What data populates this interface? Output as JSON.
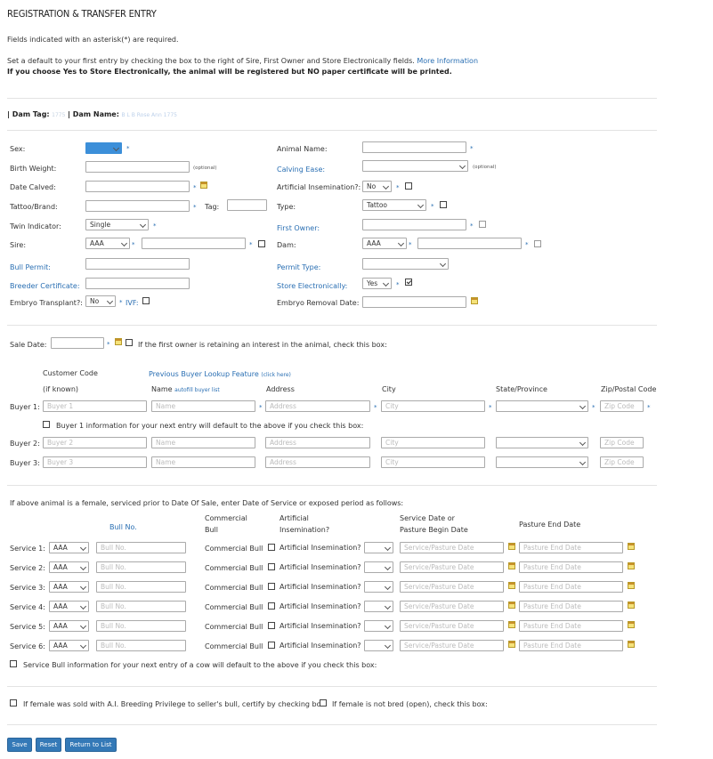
{
  "page": {
    "title": "REGISTRATION & TRANSFER ENTRY",
    "required_note": "Fields indicated with an asterisk(*) are required.",
    "default_note": "Set a default to your first entry by checking the box to the right of Sire, First Owner and Store Electronically fields.",
    "more_info": "More Information",
    "warning": "If you choose Yes to Store Electronically, the animal will be registered but NO paper certificate will be printed."
  },
  "dam": {
    "prefix": "| Dam Tag:",
    "tag_value": "1775",
    "mid": "| Dam Name:",
    "name_value": "B L B Rose Ann 1775"
  },
  "form": {
    "sex_label": "Sex:",
    "birth_weight_label": "Birth Weight:",
    "optional": "(optional)",
    "date_calved_label": "Date Calved:",
    "tattoo_label": "Tattoo/Brand:",
    "tag_label": "Tag:",
    "twin_label": "Twin Indicator:",
    "twin_value": "Single",
    "sire_label": "Sire:",
    "breed_value": "AAA",
    "bull_permit_label": "Bull Permit:",
    "breeder_cert_label": "Breeder Certificate:",
    "embryo_label": "Embryo Transplant?:",
    "no_value": "No",
    "ivf_label": "IVF:",
    "animal_name_label": "Animal Name:",
    "calving_ease_label": "Calving Ease:",
    "ai_label": "Artificial Insemination?:",
    "type_label": "Type:",
    "type_value": "Tattoo",
    "first_owner_label": "First Owner:",
    "dam_label": "Dam:",
    "permit_type_label": "Permit Type:",
    "store_label": "Store Electronically:",
    "yes_value": "Yes",
    "embryo_removal_label": "Embryo Removal Date:",
    "req": "*"
  },
  "sale": {
    "label": "Sale Date:",
    "retain_text": "If the first owner is retaining an interest in the animal, check this box:"
  },
  "buyers": {
    "customer_code": "Customer Code",
    "if_known": "(if known)",
    "lookup": "Previous Buyer Lookup Feature",
    "click_here": "(click here)",
    "name_col": "Name",
    "autofill": "autofill buyer list",
    "address_col": "Address",
    "city_col": "City",
    "state_col": "State/Province",
    "zip_col": "Zip/Postal Code",
    "default_text": "Buyer 1 information for your next entry will default to the above if you check this box:",
    "name_ph": "Name",
    "address_ph": "Address",
    "city_ph": "City",
    "zip_ph": "Zip Code",
    "rows": [
      {
        "label": "Buyer 1:",
        "code_ph": "Buyer 1"
      },
      {
        "label": "Buyer 2:",
        "code_ph": "Buyer 2"
      },
      {
        "label": "Buyer 3:",
        "code_ph": "Buyer 3"
      }
    ]
  },
  "services": {
    "intro": "If above animal is a female, serviced prior to Date Of Sale, enter Date of Service or exposed period as follows:",
    "bull_no_col": "Bull No.",
    "commercial_col_1": "Commercial",
    "commercial_col_2": "Bull",
    "ai_col_1": "Artificial",
    "ai_col_2": "Insemination?",
    "service_date_col_1": "Service Date or",
    "service_date_col_2": "Pasture Begin Date",
    "pasture_end_col": "Pasture End Date",
    "bull_ph": "Bull No.",
    "commercial_bull": "Commercial Bull",
    "ai_text": "Artificial Insemination?",
    "service_ph": "Service/Pasture Date",
    "end_ph": "Pasture End Date",
    "rows": [
      {
        "label": "Service 1:"
      },
      {
        "label": "Service 2:"
      },
      {
        "label": "Service 3:"
      },
      {
        "label": "Service 4:"
      },
      {
        "label": "Service 5:"
      },
      {
        "label": "Service 6:"
      }
    ],
    "default_text": "Service Bull information for your next entry of a cow will default to the above if you check this box:"
  },
  "certify": {
    "ai_privilege": "If female was sold with A.I. Breeding Privilege to seller's bull, certify by checking box:",
    "open": "If female is not bred (open), check this box:"
  },
  "actions": {
    "save": "Save",
    "reset": "Reset",
    "return": "Return to List"
  }
}
